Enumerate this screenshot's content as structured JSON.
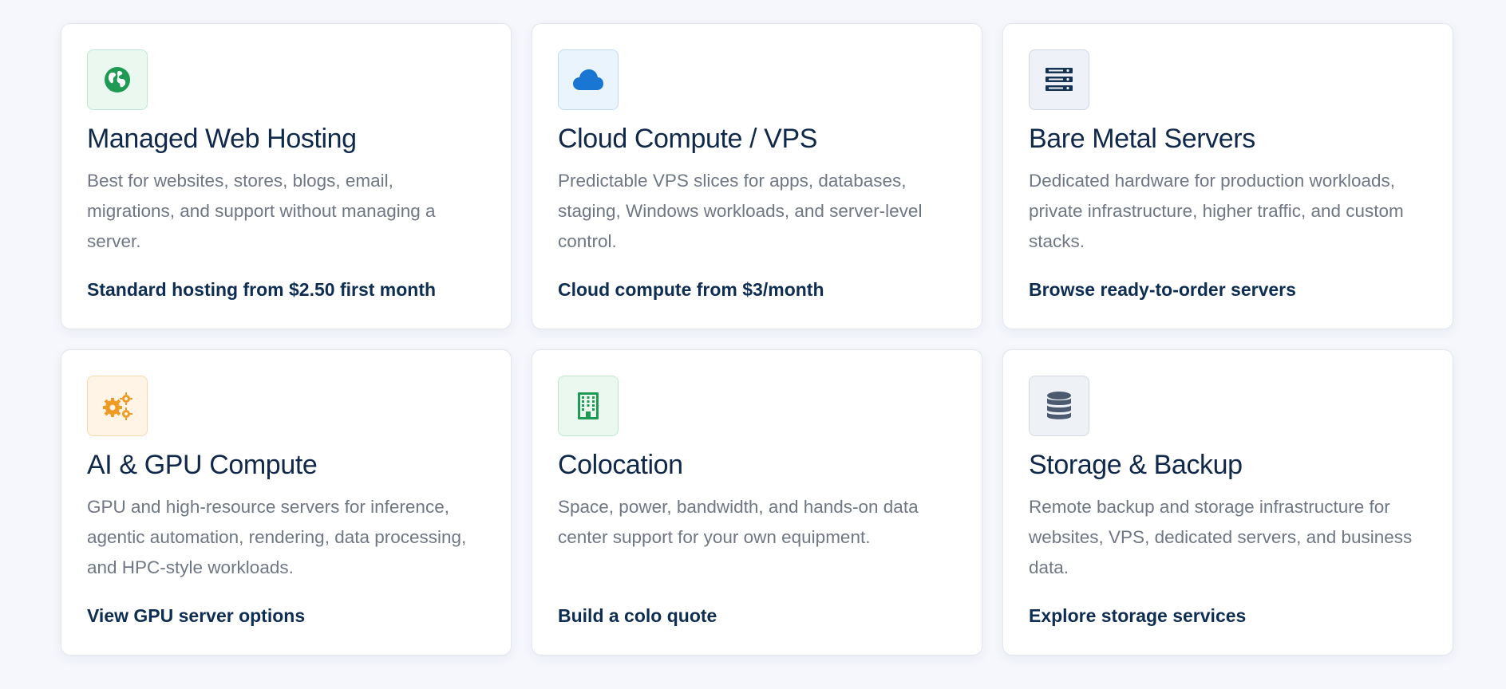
{
  "cards": [
    {
      "title": "Managed Web Hosting",
      "description": "Best for websites, stores, blogs, email, migrations, and support without managing a server.",
      "link": "Standard hosting from $2.50 first month",
      "icon": "globe-icon",
      "icon_color": "#1f9a55",
      "icon_bg": "#ebf8f0",
      "icon_border": "#bfe7cf"
    },
    {
      "title": "Cloud Compute / VPS",
      "description": "Predictable VPS slices for apps, databases, staging, Windows workloads, and server-level control.",
      "link": "Cloud compute from $3/month",
      "icon": "cloud-icon",
      "icon_color": "#1976d2",
      "icon_bg": "#eaf4fd",
      "icon_border": "#c3dcf4"
    },
    {
      "title": "Bare Metal Servers",
      "description": "Dedicated hardware for production workloads, private infrastructure, higher traffic, and custom stacks.",
      "link": "Browse ready-to-order servers",
      "icon": "server-icon",
      "icon_color": "#163354",
      "icon_bg": "#eef2f8",
      "icon_border": "#cfd8e6"
    },
    {
      "title": "AI & GPU Compute",
      "description": "GPU and high-resource servers for inference, agentic automation, rendering, data processing, and HPC-style workloads.",
      "link": "View GPU server options",
      "icon": "gears-icon",
      "icon_color": "#ef9a22",
      "icon_bg": "#fff4e6",
      "icon_border": "#f7d9b0"
    },
    {
      "title": "Colocation",
      "description": "Space, power, bandwidth, and hands-on data center support for your own equipment.",
      "link": "Build a colo quote",
      "icon": "building-icon",
      "icon_color": "#1f9a55",
      "icon_bg": "#ebf8f0",
      "icon_border": "#bfe7cf"
    },
    {
      "title": "Storage & Backup",
      "description": "Remote backup and storage infrastructure for websites, VPS, dedicated servers, and business data.",
      "link": "Explore storage services",
      "icon": "database-icon",
      "icon_color": "#4b5a6e",
      "icon_bg": "#eef1f5",
      "icon_border": "#d3d9e2"
    }
  ]
}
